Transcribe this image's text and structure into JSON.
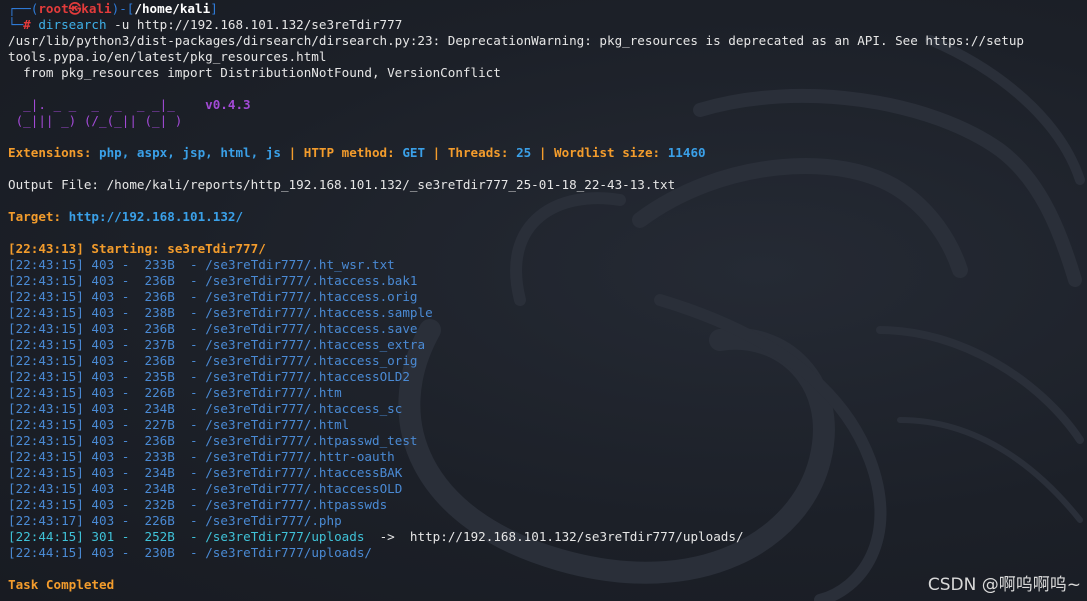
{
  "prompt": {
    "box_open": "┌──(",
    "user_host": "root㉿kali",
    "mid": ")-[",
    "cwd": "/home/kali",
    "box_close": "]",
    "corner": "└─",
    "hash": "# ",
    "command_name": "dirsearch",
    "command_args": " -u http://192.168.101.132/se3reTdir777"
  },
  "warning_lines": [
    "/usr/lib/python3/dist-packages/dirsearch/dirsearch.py:23: DeprecationWarning: pkg_resources is deprecated as an API. See https://setup",
    "tools.pypa.io/en/latest/pkg_resources.html",
    "  from pkg_resources import DistributionNotFound, VersionConflict"
  ],
  "banner": {
    "line1": "  _|. _ _  _  _  _ _|_    ",
    "line2": " (_||| _) (/_(_|| (_| )   ",
    "version": "v0.4.3"
  },
  "config": {
    "extensions_label": "Extensions: ",
    "extensions_value": "php, aspx, jsp, html, js",
    "sep": " | ",
    "method_label": "HTTP method: ",
    "method_value": "GET",
    "threads_label": "Threads: ",
    "threads_value": "25",
    "wordlist_label": "Wordlist size: ",
    "wordlist_value": "11460"
  },
  "output_file": "Output File: /home/kali/reports/http_192.168.101.132/_se3reTdir777_25-01-18_22-43-13.txt",
  "target": {
    "label": "Target: ",
    "url": "http://192.168.101.132/"
  },
  "starting": {
    "label": "[22:43:13] Starting: ",
    "path": "se3reTdir777/"
  },
  "results": [
    {
      "time": "[22:43:15]",
      "code": "403",
      "size": "233B",
      "path": "/se3reTdir777/.ht_wsr.txt",
      "redirect": ""
    },
    {
      "time": "[22:43:15]",
      "code": "403",
      "size": "236B",
      "path": "/se3reTdir777/.htaccess.bak1",
      "redirect": ""
    },
    {
      "time": "[22:43:15]",
      "code": "403",
      "size": "236B",
      "path": "/se3reTdir777/.htaccess.orig",
      "redirect": ""
    },
    {
      "time": "[22:43:15]",
      "code": "403",
      "size": "238B",
      "path": "/se3reTdir777/.htaccess.sample",
      "redirect": ""
    },
    {
      "time": "[22:43:15]",
      "code": "403",
      "size": "236B",
      "path": "/se3reTdir777/.htaccess.save",
      "redirect": ""
    },
    {
      "time": "[22:43:15]",
      "code": "403",
      "size": "237B",
      "path": "/se3reTdir777/.htaccess_extra",
      "redirect": ""
    },
    {
      "time": "[22:43:15]",
      "code": "403",
      "size": "236B",
      "path": "/se3reTdir777/.htaccess_orig",
      "redirect": ""
    },
    {
      "time": "[22:43:15]",
      "code": "403",
      "size": "235B",
      "path": "/se3reTdir777/.htaccessOLD2",
      "redirect": ""
    },
    {
      "time": "[22:43:15]",
      "code": "403",
      "size": "226B",
      "path": "/se3reTdir777/.htm",
      "redirect": ""
    },
    {
      "time": "[22:43:15]",
      "code": "403",
      "size": "234B",
      "path": "/se3reTdir777/.htaccess_sc",
      "redirect": ""
    },
    {
      "time": "[22:43:15]",
      "code": "403",
      "size": "227B",
      "path": "/se3reTdir777/.html",
      "redirect": ""
    },
    {
      "time": "[22:43:15]",
      "code": "403",
      "size": "236B",
      "path": "/se3reTdir777/.htpasswd_test",
      "redirect": ""
    },
    {
      "time": "[22:43:15]",
      "code": "403",
      "size": "233B",
      "path": "/se3reTdir777/.httr-oauth",
      "redirect": ""
    },
    {
      "time": "[22:43:15]",
      "code": "403",
      "size": "234B",
      "path": "/se3reTdir777/.htaccessBAK",
      "redirect": ""
    },
    {
      "time": "[22:43:15]",
      "code": "403",
      "size": "234B",
      "path": "/se3reTdir777/.htaccessOLD",
      "redirect": ""
    },
    {
      "time": "[22:43:15]",
      "code": "403",
      "size": "232B",
      "path": "/se3reTdir777/.htpasswds",
      "redirect": ""
    },
    {
      "time": "[22:43:17]",
      "code": "403",
      "size": "226B",
      "path": "/se3reTdir777/.php",
      "redirect": ""
    },
    {
      "time": "[22:44:15]",
      "code": "301",
      "size": "252B",
      "path": "/se3reTdir777/uploads",
      "redirect": "  ->  http://192.168.101.132/se3reTdir777/uploads/"
    },
    {
      "time": "[22:44:15]",
      "code": "403",
      "size": "230B",
      "path": "/se3reTdir777/uploads/",
      "redirect": ""
    }
  ],
  "task_completed": "Task Completed",
  "watermark": "CSDN @啊呜啊呜~"
}
